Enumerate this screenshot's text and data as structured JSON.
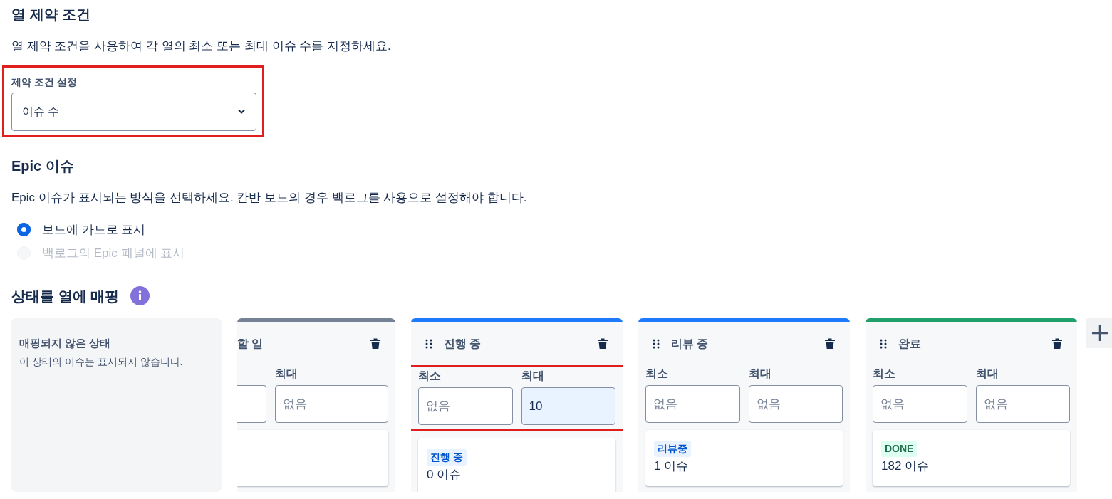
{
  "constraints": {
    "title": "열 제약 조건",
    "description": "열 제약 조건을 사용하여 각 열의 최소 또는 최대 이슈 수를 지정하세요.",
    "highlighted": true,
    "label": "제약 조건 설정",
    "value": "이슈 수"
  },
  "epic": {
    "title": "Epic 이슈",
    "description": "Epic 이슈가 표시되는 방식을 선택하세요. 칸반 보드의 경우 백로그를 사용으로 설정해야 합니다.",
    "options": [
      {
        "label": "보드에 카드로 표시",
        "selected": true,
        "disabled": false
      },
      {
        "label": "백로그의 Epic 패널에 표시",
        "selected": false,
        "disabled": true
      }
    ]
  },
  "mapping": {
    "title": "상태를 열에 매핑",
    "unmapped": {
      "title": "매핑되지 않은 상태",
      "description": "이 상태의 이슈는 표시되지 않습니다."
    },
    "columns": [
      {
        "kind": "clipped",
        "title": "할 일",
        "color": "#758195",
        "max_label": "최대",
        "max_placeholder": "없음"
      },
      {
        "kind": "full",
        "title": "진행 중",
        "color": "#1d7afc",
        "highlighted": true,
        "min_label": "최소",
        "min_placeholder": "없음",
        "max_label": "최대",
        "max_value": "10",
        "status": {
          "label": "진행 중",
          "kind": "progress"
        },
        "count": "0",
        "count_unit": "이슈"
      },
      {
        "kind": "full",
        "title": "리뷰 중",
        "color": "#1d7afc",
        "highlighted": false,
        "min_label": "최소",
        "min_placeholder": "없음",
        "max_label": "최대",
        "max_placeholder": "없음",
        "status": {
          "label": "리뷰중",
          "kind": "progress"
        },
        "count": "1",
        "count_unit": "이슈"
      },
      {
        "kind": "full",
        "title": "완료",
        "color": "#22a06b",
        "highlighted": false,
        "min_label": "최소",
        "min_placeholder": "없음",
        "max_label": "최대",
        "max_placeholder": "없음",
        "status": {
          "label": "DONE",
          "kind": "done"
        },
        "count": "182",
        "count_unit": "이슈"
      }
    ]
  }
}
